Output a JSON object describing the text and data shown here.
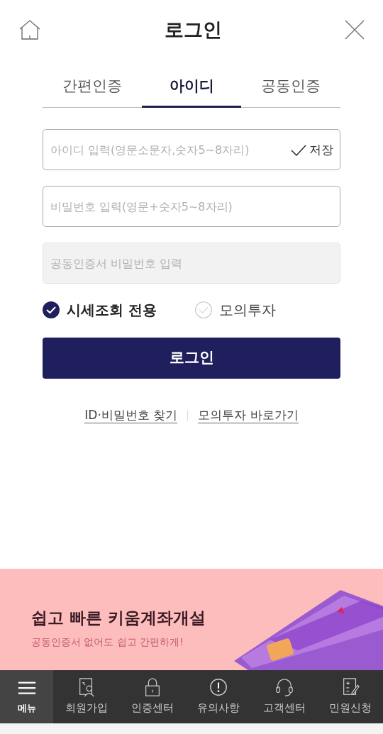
{
  "header": {
    "title": "로그인"
  },
  "tabs": [
    {
      "label": "간편인증",
      "selected": false
    },
    {
      "label": "아이디",
      "selected": true
    },
    {
      "label": "공동인증",
      "selected": false
    }
  ],
  "fields": [
    {
      "placeholder": "아이디 입력(영문소문자,숫자5~8자리)",
      "disabled": false,
      "save": {
        "label": "저장"
      }
    },
    {
      "placeholder": "비밀번호 입력(영문+숫자5~8자리)",
      "disabled": false
    },
    {
      "placeholder": "공동인증서 비밀번호 입력",
      "disabled": true
    }
  ],
  "options": [
    {
      "label": "시세조회 전용",
      "checked": true
    },
    {
      "label": "모의투자",
      "checked": false
    }
  ],
  "login_button": "로그인",
  "links": [
    "ID·비밀번호 찾기",
    "모의투자 바로가기"
  ],
  "banner": {
    "title": "쉽고 빠른 키움계좌개설",
    "subtitle": "공동인증서 없어도 쉽고 간편하게!",
    "kind": "picture"
  },
  "bottom_nav": [
    {
      "label": "메뉴",
      "selected": true
    },
    {
      "label": "회원가입",
      "selected": false
    },
    {
      "label": "인증센터",
      "selected": false
    },
    {
      "label": "유의사항",
      "selected": false
    },
    {
      "label": "고객센터",
      "selected": false
    },
    {
      "label": "민원신청",
      "selected": false
    }
  ]
}
